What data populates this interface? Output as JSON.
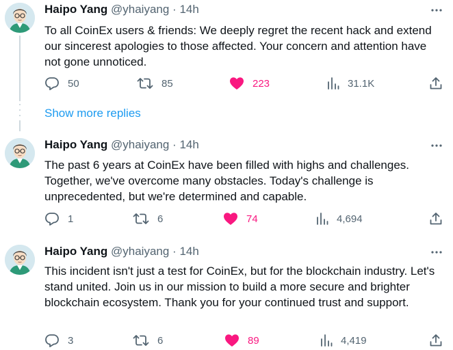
{
  "tweets": [
    {
      "name": "Haipo Yang",
      "handle": "@yhaiyang",
      "sep": "·",
      "time": "14h",
      "text": "To all CoinEx users & friends: We deeply regret the recent hack and extend our sincerest apologies to those affected. Your concern and attention have not gone unnoticed.",
      "replies": "50",
      "retweets": "85",
      "likes": "223",
      "views": "31.1K"
    },
    {
      "name": "Haipo Yang",
      "handle": "@yhaiyang",
      "sep": "·",
      "time": "14h",
      "text": "The past 6 years at CoinEx have been filled with highs and challenges. Together, we've overcome many obstacles. Today's challenge is unprecedented, but we're determined and capable.",
      "replies": "1",
      "retweets": "6",
      "likes": "74",
      "views": "4,694"
    },
    {
      "name": "Haipo Yang",
      "handle": "@yhaiyang",
      "sep": "·",
      "time": "14h",
      "text": "This incident isn't just a test for CoinEx, but for the blockchain industry. Let's stand united. Join us in our mission to build a more secure and brighter blockchain ecosystem. Thank you for your continued trust and support.",
      "replies": "3",
      "retweets": "6",
      "likes": "89",
      "views": "4,419"
    }
  ],
  "show_more_replies": "Show more replies",
  "colors": {
    "like": "#f91880",
    "link": "#1d9bf0",
    "muted": "#536471"
  }
}
